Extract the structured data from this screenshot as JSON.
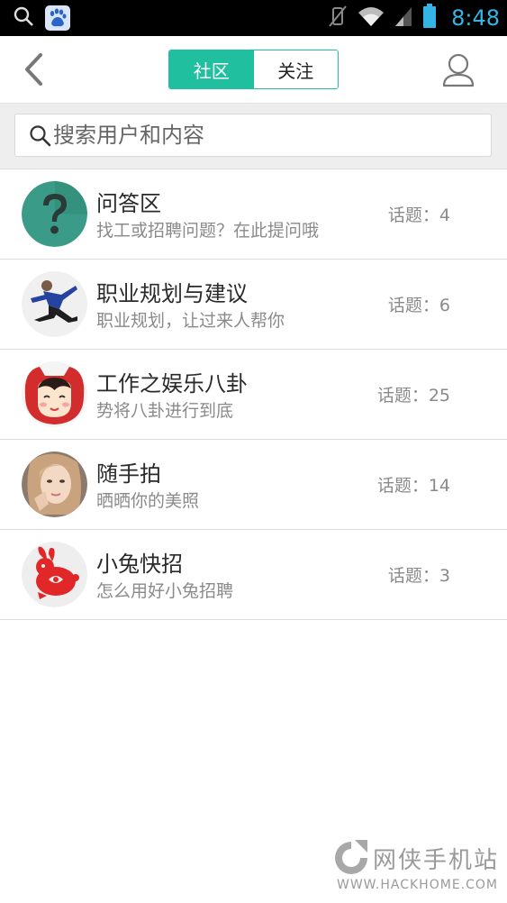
{
  "status_bar": {
    "time": "8:48"
  },
  "header": {
    "tabs": [
      {
        "label": "社区",
        "active": true
      },
      {
        "label": "关注",
        "active": false
      }
    ]
  },
  "search": {
    "placeholder": "搜索用户和内容"
  },
  "topics": [
    {
      "title": "问答区",
      "subtitle": "找工或招聘问题？在此提问哦",
      "count": "话题：4"
    },
    {
      "title": "职业规划与建议",
      "subtitle": "职业规划，让过来人帮你",
      "count": "话题：6"
    },
    {
      "title": "工作之娱乐八卦",
      "subtitle": "势将八卦进行到底",
      "count": "话题：25"
    },
    {
      "title": "随手拍",
      "subtitle": "晒晒你的美照",
      "count": "话题：14"
    },
    {
      "title": "小兔快招",
      "subtitle": "怎么用好小兔招聘",
      "count": "话题：3"
    }
  ],
  "watermark": {
    "name": "网侠手机站",
    "url": "WWW.HACKHOME.COM"
  },
  "colors": {
    "accent": "#1fbf9f",
    "status_time": "#33b5e5"
  }
}
